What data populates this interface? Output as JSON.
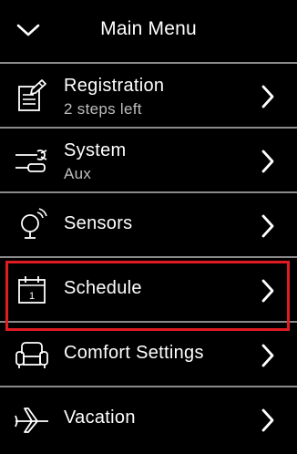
{
  "header": {
    "title": "Main Menu",
    "back_icon": "chevron-down-icon"
  },
  "menu": {
    "items": [
      {
        "label": "Registration",
        "sublabel": "2 steps left",
        "icon": "registration-form-icon"
      },
      {
        "label": "System",
        "sublabel": "Aux",
        "icon": "tools-icon"
      },
      {
        "label": "Sensors",
        "icon": "sensor-icon"
      },
      {
        "label": "Schedule",
        "icon": "calendar-icon",
        "highlighted": true
      },
      {
        "label": "Comfort Settings",
        "icon": "armchair-icon"
      },
      {
        "label": "Vacation",
        "icon": "airplane-icon"
      }
    ]
  },
  "colors": {
    "background": "#000000",
    "text": "#ffffff",
    "subtext": "#bdbdbd",
    "divider": "#8a8a8a",
    "highlight": "#e01b24"
  }
}
